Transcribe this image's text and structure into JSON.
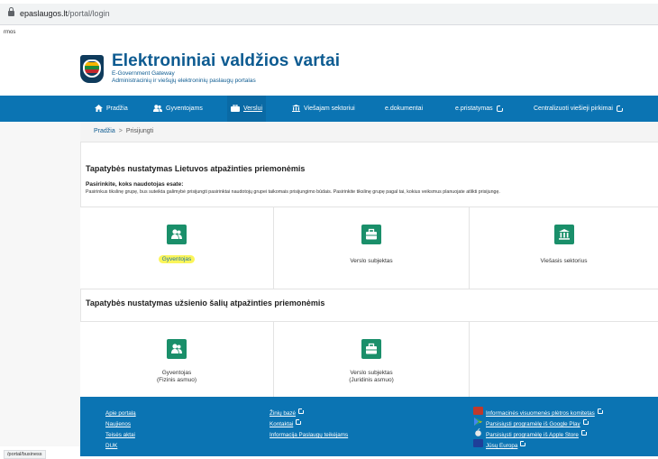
{
  "browser": {
    "url_domain": "epaslaugos.lt",
    "url_path": "/portal/login",
    "tab_fragment": "rmos",
    "status_url": "/portal/business"
  },
  "header": {
    "title": "Elektroniniai valdžios vartai",
    "subtitle_en": "E-Government Gateway",
    "subtitle_lt": "Administracinių ir viešųjų elektroninių paslaugų portalas"
  },
  "nav": {
    "items": [
      {
        "label": "Pradžia",
        "icon": "home-icon"
      },
      {
        "label": "Gyventojams",
        "icon": "people-icon"
      },
      {
        "label": "Verslui",
        "icon": "briefcase-icon",
        "active": true
      },
      {
        "label": "Viešajam sektoriui",
        "icon": "institution-icon"
      },
      {
        "label": "e.dokumentai"
      },
      {
        "label": "e.pristatymas",
        "external": true
      },
      {
        "label": "Centralizuoti viešieji pirkimai",
        "external": true
      }
    ]
  },
  "breadcrumb": {
    "home": "Pradžia",
    "separator": ">",
    "current": "Prisijungti"
  },
  "lt_auth": {
    "heading": "Tapatybės nustatymas Lietuvos atpažinties priemonėmis",
    "prompt_bold": "Pasirinkite, koks naudotojas esate:",
    "prompt_text": "Pasirinkus tikslinę grupę, bus suteikta galimybė prisijungti pasirinktai naudotojų grupei taikomais prisijungimo būdais. Pasirinkite tikslinę grupę pagal tai, kokius veiksmus planuojate atlikti prisijungę.",
    "options": [
      {
        "label": "Gyventojas",
        "icon": "people-icon",
        "highlighted": true
      },
      {
        "label": "Verslo subjektas",
        "icon": "briefcase-icon"
      },
      {
        "label": "Viešasis sektorius",
        "icon": "institution-icon"
      }
    ]
  },
  "foreign_auth": {
    "heading": "Tapatybės nustatymas užsienio šalių atpažinties priemonėmis",
    "options": [
      {
        "label": "Gyventojas",
        "sublabel": "(Fizinis asmuo)",
        "icon": "people-icon"
      },
      {
        "label": "Verslo subjektas",
        "sublabel": "(Juridinis asmuo)",
        "icon": "briefcase-icon"
      }
    ]
  },
  "footer": {
    "col1": [
      "Apie portalą",
      "Naujienos",
      "Teisės aktai",
      "DUK"
    ],
    "col2": [
      {
        "label": "Žinių bazė",
        "external": true
      },
      {
        "label": "Kontaktai",
        "external": true
      },
      {
        "label": "Informacija Paslaugų teikėjams"
      }
    ],
    "col3": [
      {
        "label": "Informacinės visuomenės plėtros komitetas",
        "external": true,
        "icon": "ivpk-logo-icon"
      },
      {
        "label": "Parsisiųsti programėlę iš Google Play",
        "external": true,
        "icon": "google-play-icon"
      },
      {
        "label": "Parsisiųsti programėlę iš Apple Store",
        "external": true,
        "icon": "apple-icon"
      },
      {
        "label": "Jūsų Europa",
        "external": true,
        "icon": "eu-flag-icon"
      }
    ]
  },
  "colors": {
    "nav_bg": "#0b74b3",
    "brand": "#0d5b91",
    "tile_icon": "#1a8f6a",
    "highlight": "#fbf55a"
  }
}
